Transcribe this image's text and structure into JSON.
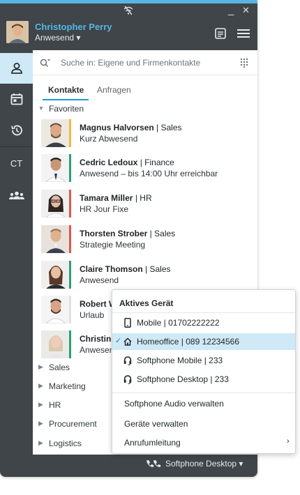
{
  "header": {
    "user_name": "Christopher Perry",
    "user_status": "Anwesend ▾",
    "window_minimize": "_",
    "window_close": "✕"
  },
  "rail": {
    "items": [
      {
        "icon": "person-icon"
      },
      {
        "icon": "calendar-icon"
      },
      {
        "icon": "history-icon"
      },
      {
        "label": "CT"
      },
      {
        "icon": "group-icon"
      }
    ]
  },
  "search": {
    "placeholder": "Suche in: Eigene und Firmenkontakte"
  },
  "tabs": [
    {
      "label": "Kontakte"
    },
    {
      "label": "Anfragen"
    }
  ],
  "favorites_label": "Favoriten",
  "contacts": [
    {
      "name": "Magnus Halvorsen",
      "dept": "Sales",
      "status": "Kurz Abwesend",
      "status_color": "#f2b93b"
    },
    {
      "name": "Cedric Ledoux",
      "dept": "Finance",
      "status": "Anwesend – bis 14:00 Uhr erreichbar",
      "status_color": "#2a9e77"
    },
    {
      "name": "Tamara Miller",
      "dept": "HR",
      "status": "HR Jour Fixe",
      "status_color": "#e0564e"
    },
    {
      "name": "Thorsten Strober",
      "dept": "Sales",
      "status": "Strategie Meeting",
      "status_color": "#e0564e"
    },
    {
      "name": "Claire Thomson",
      "dept": "Sales",
      "status": "Anwesend",
      "status_color": "#2a9e77"
    },
    {
      "name": "Robert W",
      "dept": "",
      "status": "Urlaub",
      "status_color": "#dfe2e4"
    },
    {
      "name": "Christine",
      "dept": "",
      "status": "Anwesen",
      "status_color": "#2a9e77"
    }
  ],
  "groups": [
    "Sales",
    "Marketing",
    "HR",
    "Procurement",
    "Logistics"
  ],
  "device_menu": {
    "title": "Aktives Gerät",
    "devices": [
      {
        "icon": "mobile-phone-icon",
        "label": "Mobile | 01702222222",
        "selected": false
      },
      {
        "icon": "home-icon",
        "label": "Homeoffice | 089 12234566",
        "selected": true
      },
      {
        "icon": "headset-icon",
        "label": "Softphone Mobile | 233",
        "selected": false
      },
      {
        "icon": "headset-icon",
        "label": "Softphone Desktop | 233",
        "selected": false
      }
    ],
    "actions": [
      "Softphone Audio verwalten",
      "Geräte verwalten",
      "Anrufumleitung"
    ],
    "check_mark": "✓",
    "submenu_arrow": "›"
  },
  "bottom": {
    "active_device": "Softphone Desktop ▾"
  },
  "colors": {
    "accent": "#1c9bd8",
    "dark_bg": "#3f4549",
    "selected_bg": "#cfe9f6"
  }
}
